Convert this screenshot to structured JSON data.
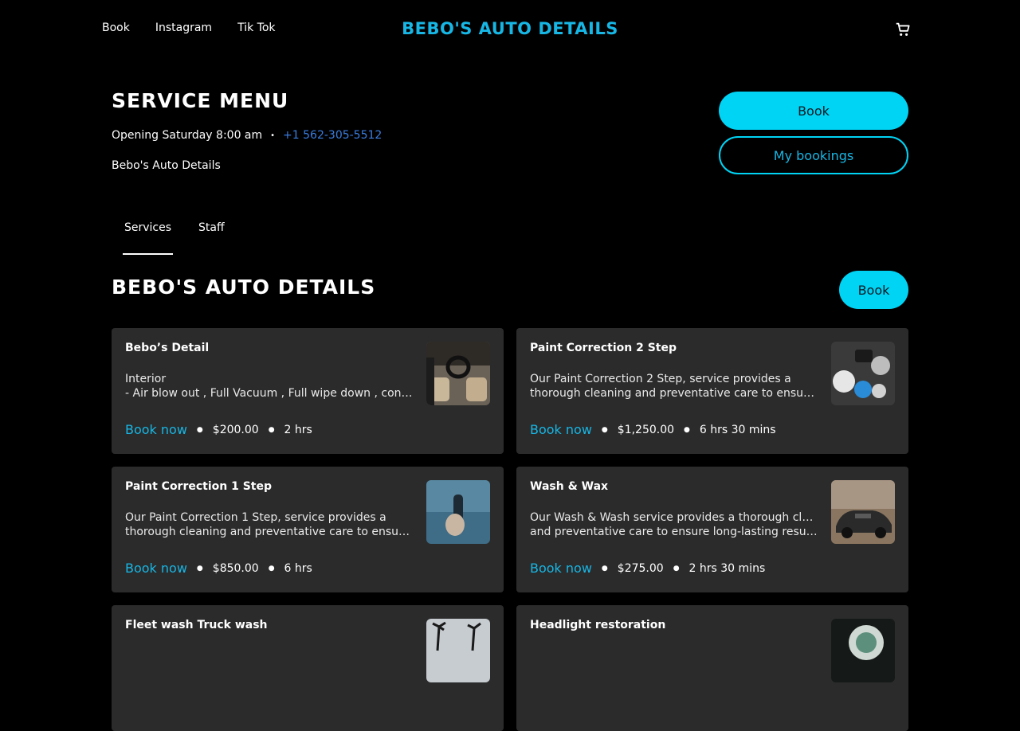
{
  "nav": {
    "links": [
      "Book",
      "Instagram",
      "Tik Tok"
    ],
    "brand": "Bebo's Auto Details"
  },
  "header": {
    "title": "Service Menu",
    "opening": "Opening Saturday 8:00 am",
    "dot": "•",
    "phone": "+1 562-305-5512",
    "business": "Bebo's Auto Details",
    "book_label": "Book",
    "bookings_label": "My bookings"
  },
  "tabs": [
    "Services",
    "Staff"
  ],
  "section": {
    "title": "Bebo's Auto Details",
    "book_label": "Book"
  },
  "cards": [
    {
      "title": "Bebo’s Detail",
      "desc1": "Interior",
      "desc2": "- Air blow out , Full Vacuum , Full wipe down , conditioning",
      "book": "Book now",
      "price": "$200.00",
      "duration": "2 hrs"
    },
    {
      "title": "Paint Correction 2 Step",
      "desc1": "Our Paint Correction 2 Step, service provides a",
      "desc2": "thorough cleaning and preventative care to ensure long-lasting",
      "book": "Book now",
      "price": "$1,250.00",
      "duration": "6 hrs 30 mins"
    },
    {
      "title": "Paint Correction 1 Step",
      "desc1": "Our Paint Correction 1 Step, service provides a",
      "desc2": "thorough cleaning and preventative care to ensure long-lasting",
      "book": "Book now",
      "price": "$850.00",
      "duration": "6 hrs"
    },
    {
      "title": "Wash & Wax",
      "desc1": "Our Wash & Wash service provides a thorough cleaning",
      "desc2": "and preventative care to ensure long-lasting results for",
      "book": "Book now",
      "price": "$275.00",
      "duration": "2 hrs 30 mins"
    },
    {
      "title": "Fleet wash Truck wash",
      "desc1": "",
      "desc2": "",
      "book": "",
      "price": "",
      "duration": ""
    },
    {
      "title": "Headlight restoration",
      "desc1": "",
      "desc2": "",
      "book": "",
      "price": "",
      "duration": ""
    }
  ],
  "colors": {
    "accent": "#00d4f5",
    "brand": "#17b6e4",
    "card_bg": "#2b2b2b",
    "link": "#3a7de0"
  }
}
